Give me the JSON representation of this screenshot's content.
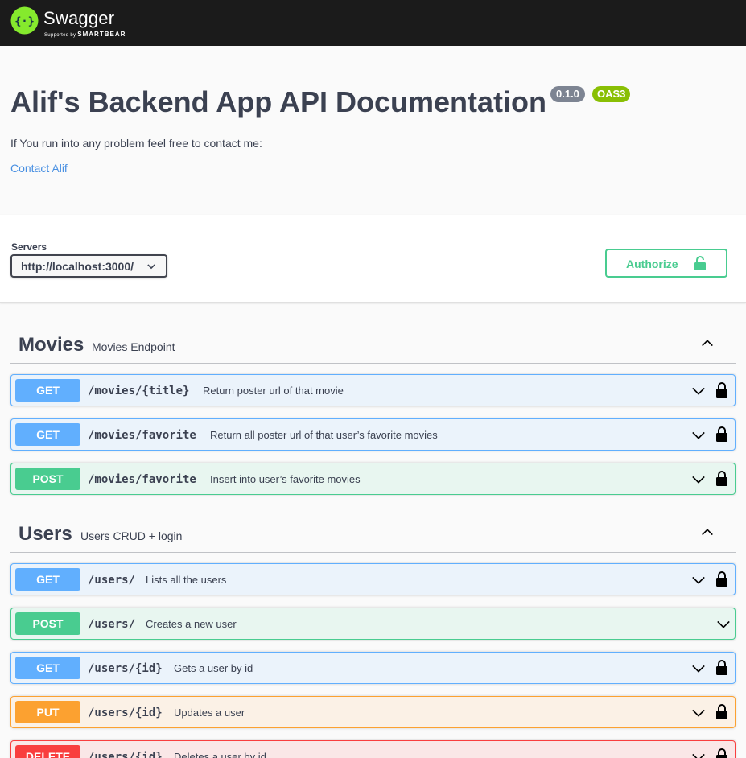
{
  "topbar": {
    "brand": "Swagger",
    "sub_prefix": "Supported by",
    "sub_brand": "SMARTBEAR"
  },
  "info": {
    "title": "Alif's Backend App API Documentation",
    "version": "0.1.0",
    "oas": "OAS3",
    "description": "If You run into any problem feel free to contact me:",
    "contact_link": "Contact Alif"
  },
  "servers": {
    "label": "Servers",
    "selected": "http://localhost:3000/"
  },
  "authorize_label": "Authorize",
  "colors": {
    "get": "#61affe",
    "post": "#49cc90",
    "put": "#fca130",
    "delete": "#f93e3e",
    "brand_green": "#85ea2d"
  },
  "tags": [
    {
      "name": "Movies",
      "description": "Movies Endpoint",
      "operations": [
        {
          "method": "GET",
          "path": "/movies/{title}",
          "summary": "Return poster url of that movie",
          "locked": true
        },
        {
          "method": "GET",
          "path": "/movies/favorite",
          "summary": "Return all poster url of that user’s favorite movies",
          "locked": true
        },
        {
          "method": "POST",
          "path": "/movies/favorite",
          "summary": "Insert into user’s favorite movies",
          "locked": true
        }
      ]
    },
    {
      "name": "Users",
      "description": "Users CRUD + login",
      "operations": [
        {
          "method": "GET",
          "path": "/users/",
          "summary": "Lists all the users",
          "locked": true
        },
        {
          "method": "POST",
          "path": "/users/",
          "summary": "Creates a new user",
          "locked": false
        },
        {
          "method": "GET",
          "path": "/users/{id}",
          "summary": "Gets a user by id",
          "locked": true
        },
        {
          "method": "PUT",
          "path": "/users/{id}",
          "summary": "Updates a user",
          "locked": true
        },
        {
          "method": "DELETE",
          "path": "/users/{id}",
          "summary": "Deletes a user by id",
          "locked": true
        }
      ]
    }
  ]
}
